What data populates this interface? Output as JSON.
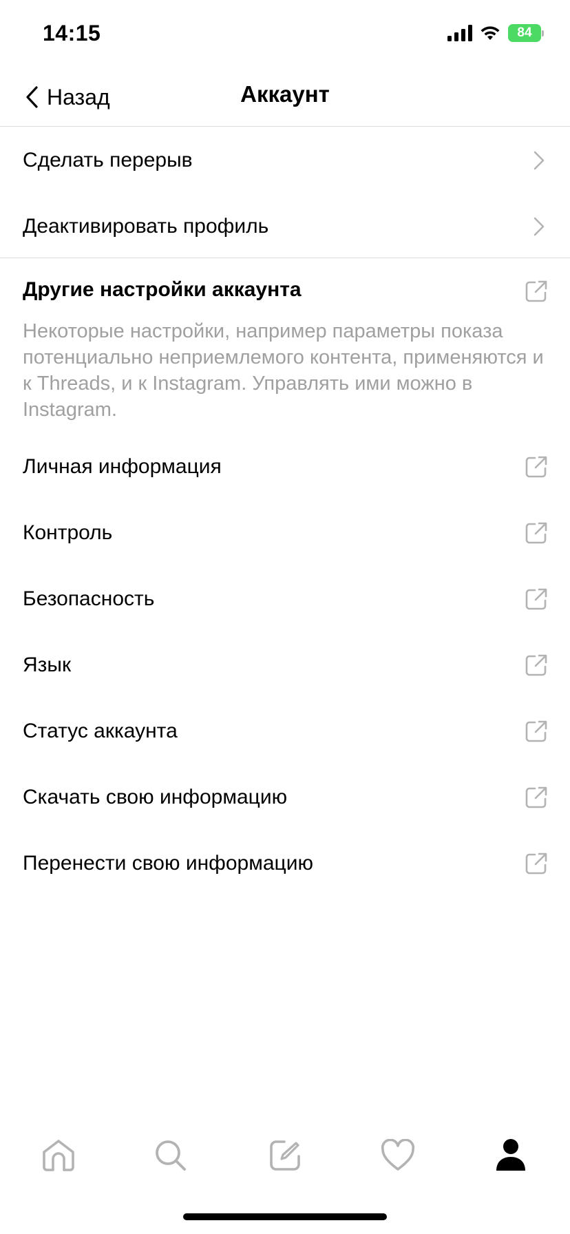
{
  "status_bar": {
    "time": "14:15",
    "battery": "84"
  },
  "nav": {
    "back_label": "Назад",
    "title": "Аккаунт"
  },
  "group1": [
    {
      "label": "Сделать перерыв"
    },
    {
      "label": "Деактивировать профиль"
    }
  ],
  "other_settings": {
    "title": "Другие настройки аккаунта",
    "description": "Некоторые настройки, например параметры показа потенциально неприемлемого контента, применяются и к Threads, и к Instagram. Управлять ими можно в Instagram.",
    "items": [
      {
        "label": "Личная информация"
      },
      {
        "label": "Контроль"
      },
      {
        "label": "Безопасность"
      },
      {
        "label": "Язык"
      },
      {
        "label": "Статус аккаунта"
      },
      {
        "label": "Скачать свою информацию"
      },
      {
        "label": "Перенести свою информацию"
      }
    ]
  },
  "tab_bar": {
    "tabs": [
      {
        "icon": "home-icon",
        "active": false
      },
      {
        "icon": "search-icon",
        "active": false
      },
      {
        "icon": "compose-icon",
        "active": false
      },
      {
        "icon": "heart-icon",
        "active": false
      },
      {
        "icon": "profile-icon",
        "active": true
      }
    ]
  },
  "colors": {
    "battery": "#4cd964",
    "muted_text": "#a0a0a0",
    "icon_gray": "#b3b3b3",
    "divider": "#dcdcdc"
  }
}
